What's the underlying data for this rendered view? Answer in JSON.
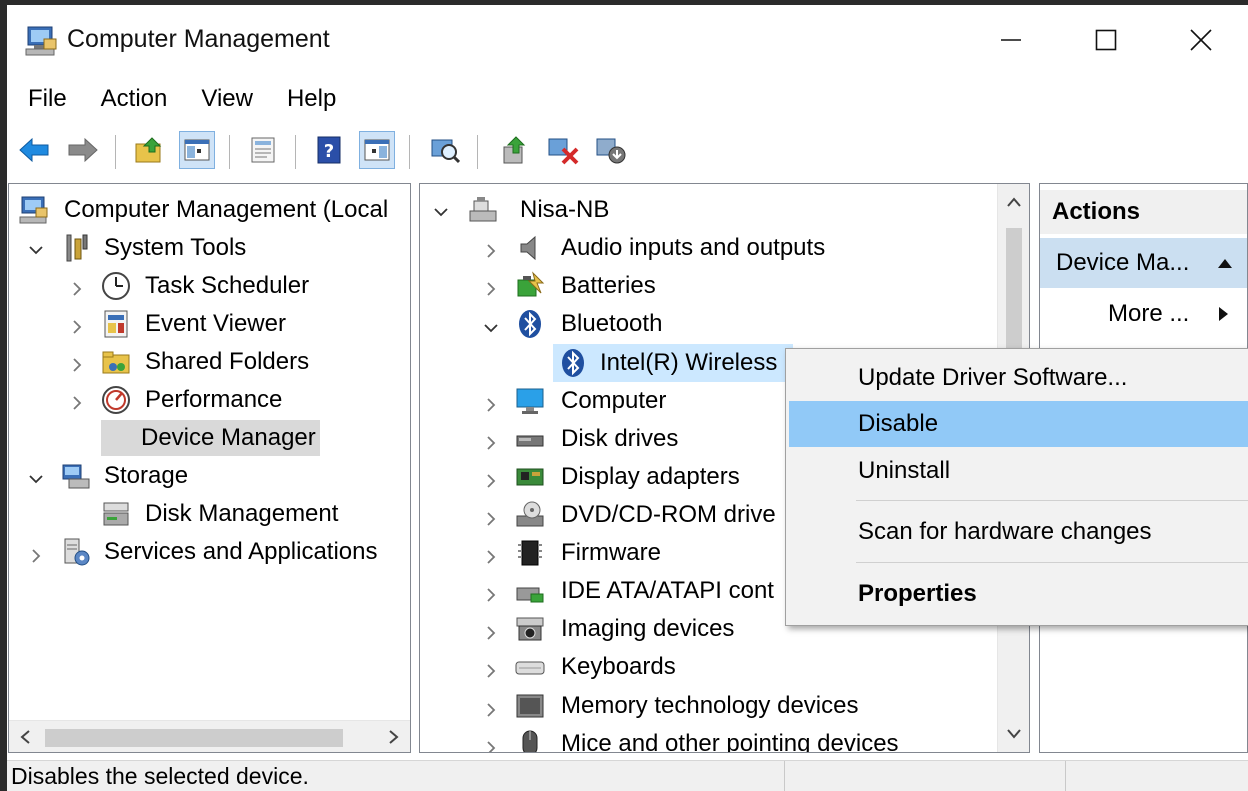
{
  "window": {
    "title": "Computer Management"
  },
  "menubar": {
    "items": [
      "File",
      "Action",
      "View",
      "Help"
    ]
  },
  "left_tree": [
    {
      "label": "Computer Management (Local",
      "icon": "computer-management-icon"
    },
    {
      "label": "System Tools",
      "icon": "tools-icon"
    },
    {
      "label": "Task Scheduler",
      "icon": "clock-icon"
    },
    {
      "label": "Event Viewer",
      "icon": "event-viewer-icon"
    },
    {
      "label": "Shared Folders",
      "icon": "shared-folder-icon"
    },
    {
      "label": "Performance",
      "icon": "performance-icon"
    },
    {
      "label": "Device Manager",
      "icon": "device-manager-icon"
    },
    {
      "label": "Storage",
      "icon": "storage-icon"
    },
    {
      "label": "Disk Management",
      "icon": "disk-management-icon"
    },
    {
      "label": "Services and Applications",
      "icon": "services-icon"
    }
  ],
  "device_tree": [
    {
      "label": "Nisa-NB",
      "icon": "computer-icon"
    },
    {
      "label": "Audio inputs and outputs",
      "icon": "speaker-icon"
    },
    {
      "label": "Batteries",
      "icon": "battery-icon"
    },
    {
      "label": "Bluetooth",
      "icon": "bluetooth-icon"
    },
    {
      "label": "Intel(R) Wireless",
      "icon": "bluetooth-icon"
    },
    {
      "label": "Computer",
      "icon": "monitor-icon"
    },
    {
      "label": "Disk drives",
      "icon": "disk-drive-icon"
    },
    {
      "label": "Display adapters",
      "icon": "display-adapter-icon"
    },
    {
      "label": "DVD/CD-ROM drive",
      "icon": "dvd-icon"
    },
    {
      "label": "Firmware",
      "icon": "firmware-icon"
    },
    {
      "label": "IDE ATA/ATAPI cont",
      "icon": "ide-icon"
    },
    {
      "label": "Imaging devices",
      "icon": "camera-icon"
    },
    {
      "label": "Keyboards",
      "icon": "keyboard-icon"
    },
    {
      "label": "Memory technology devices",
      "icon": "memory-icon"
    },
    {
      "label": "Mice and other pointing devices",
      "icon": "mouse-icon"
    }
  ],
  "actions": {
    "header": "Actions",
    "section": "Device Ma...",
    "more": "More ..."
  },
  "context_menu": {
    "items": [
      "Update Driver Software...",
      "Disable",
      "Uninstall",
      "Scan for hardware changes",
      "Properties"
    ]
  },
  "status": {
    "text": "Disables the selected device."
  },
  "colors": {
    "selection_blue": "#cce8ff",
    "menu_highlight": "#91c9f7",
    "actions_section": "#cbdff1"
  }
}
